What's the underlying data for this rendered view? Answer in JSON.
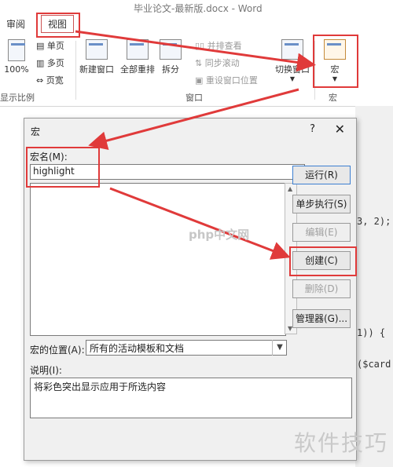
{
  "window": {
    "title": "毕业论文-最新版.docx - Word"
  },
  "tabs": {
    "review": "审阅",
    "view": "视图"
  },
  "ribbon": {
    "btn_100": "100%",
    "single_page": "单页",
    "multi_page": "多页",
    "page_width": "页宽",
    "zoom_group": "显示比例",
    "new_window": "新建窗口",
    "arrange_all": "全部重排",
    "split": "拆分",
    "side_by_side": "并排查看",
    "sync_scroll": "同步滚动",
    "reset_window": "重设窗口位置",
    "switch_window": "切换窗口",
    "window_group": "窗口",
    "macro": "宏",
    "macro_group": "宏"
  },
  "code_lines": [
    "3, 2);",
    "1)) {",
    "($card"
  ],
  "dialog": {
    "title": "宏",
    "help": "?",
    "close": "✕",
    "macro_name_label": "宏名(M):",
    "macro_name_value": "highlight",
    "buttons": {
      "run": "运行(R)",
      "step": "单步执行(S)",
      "edit": "编辑(E)",
      "create": "创建(C)",
      "delete": "删除(D)",
      "organizer": "管理器(G)..."
    },
    "location_label": "宏的位置(A):",
    "location_value": "所有的活动模板和文档",
    "description_label": "说明(I):",
    "description_value": "将彩色突出显示应用于所选内容"
  },
  "watermarks": {
    "php": "php中文网",
    "corner": "软件技巧"
  },
  "colors": {
    "highlight": "#e03a3a",
    "dialog_bg": "#f0f0f0",
    "accent": "#3c7fd1"
  }
}
